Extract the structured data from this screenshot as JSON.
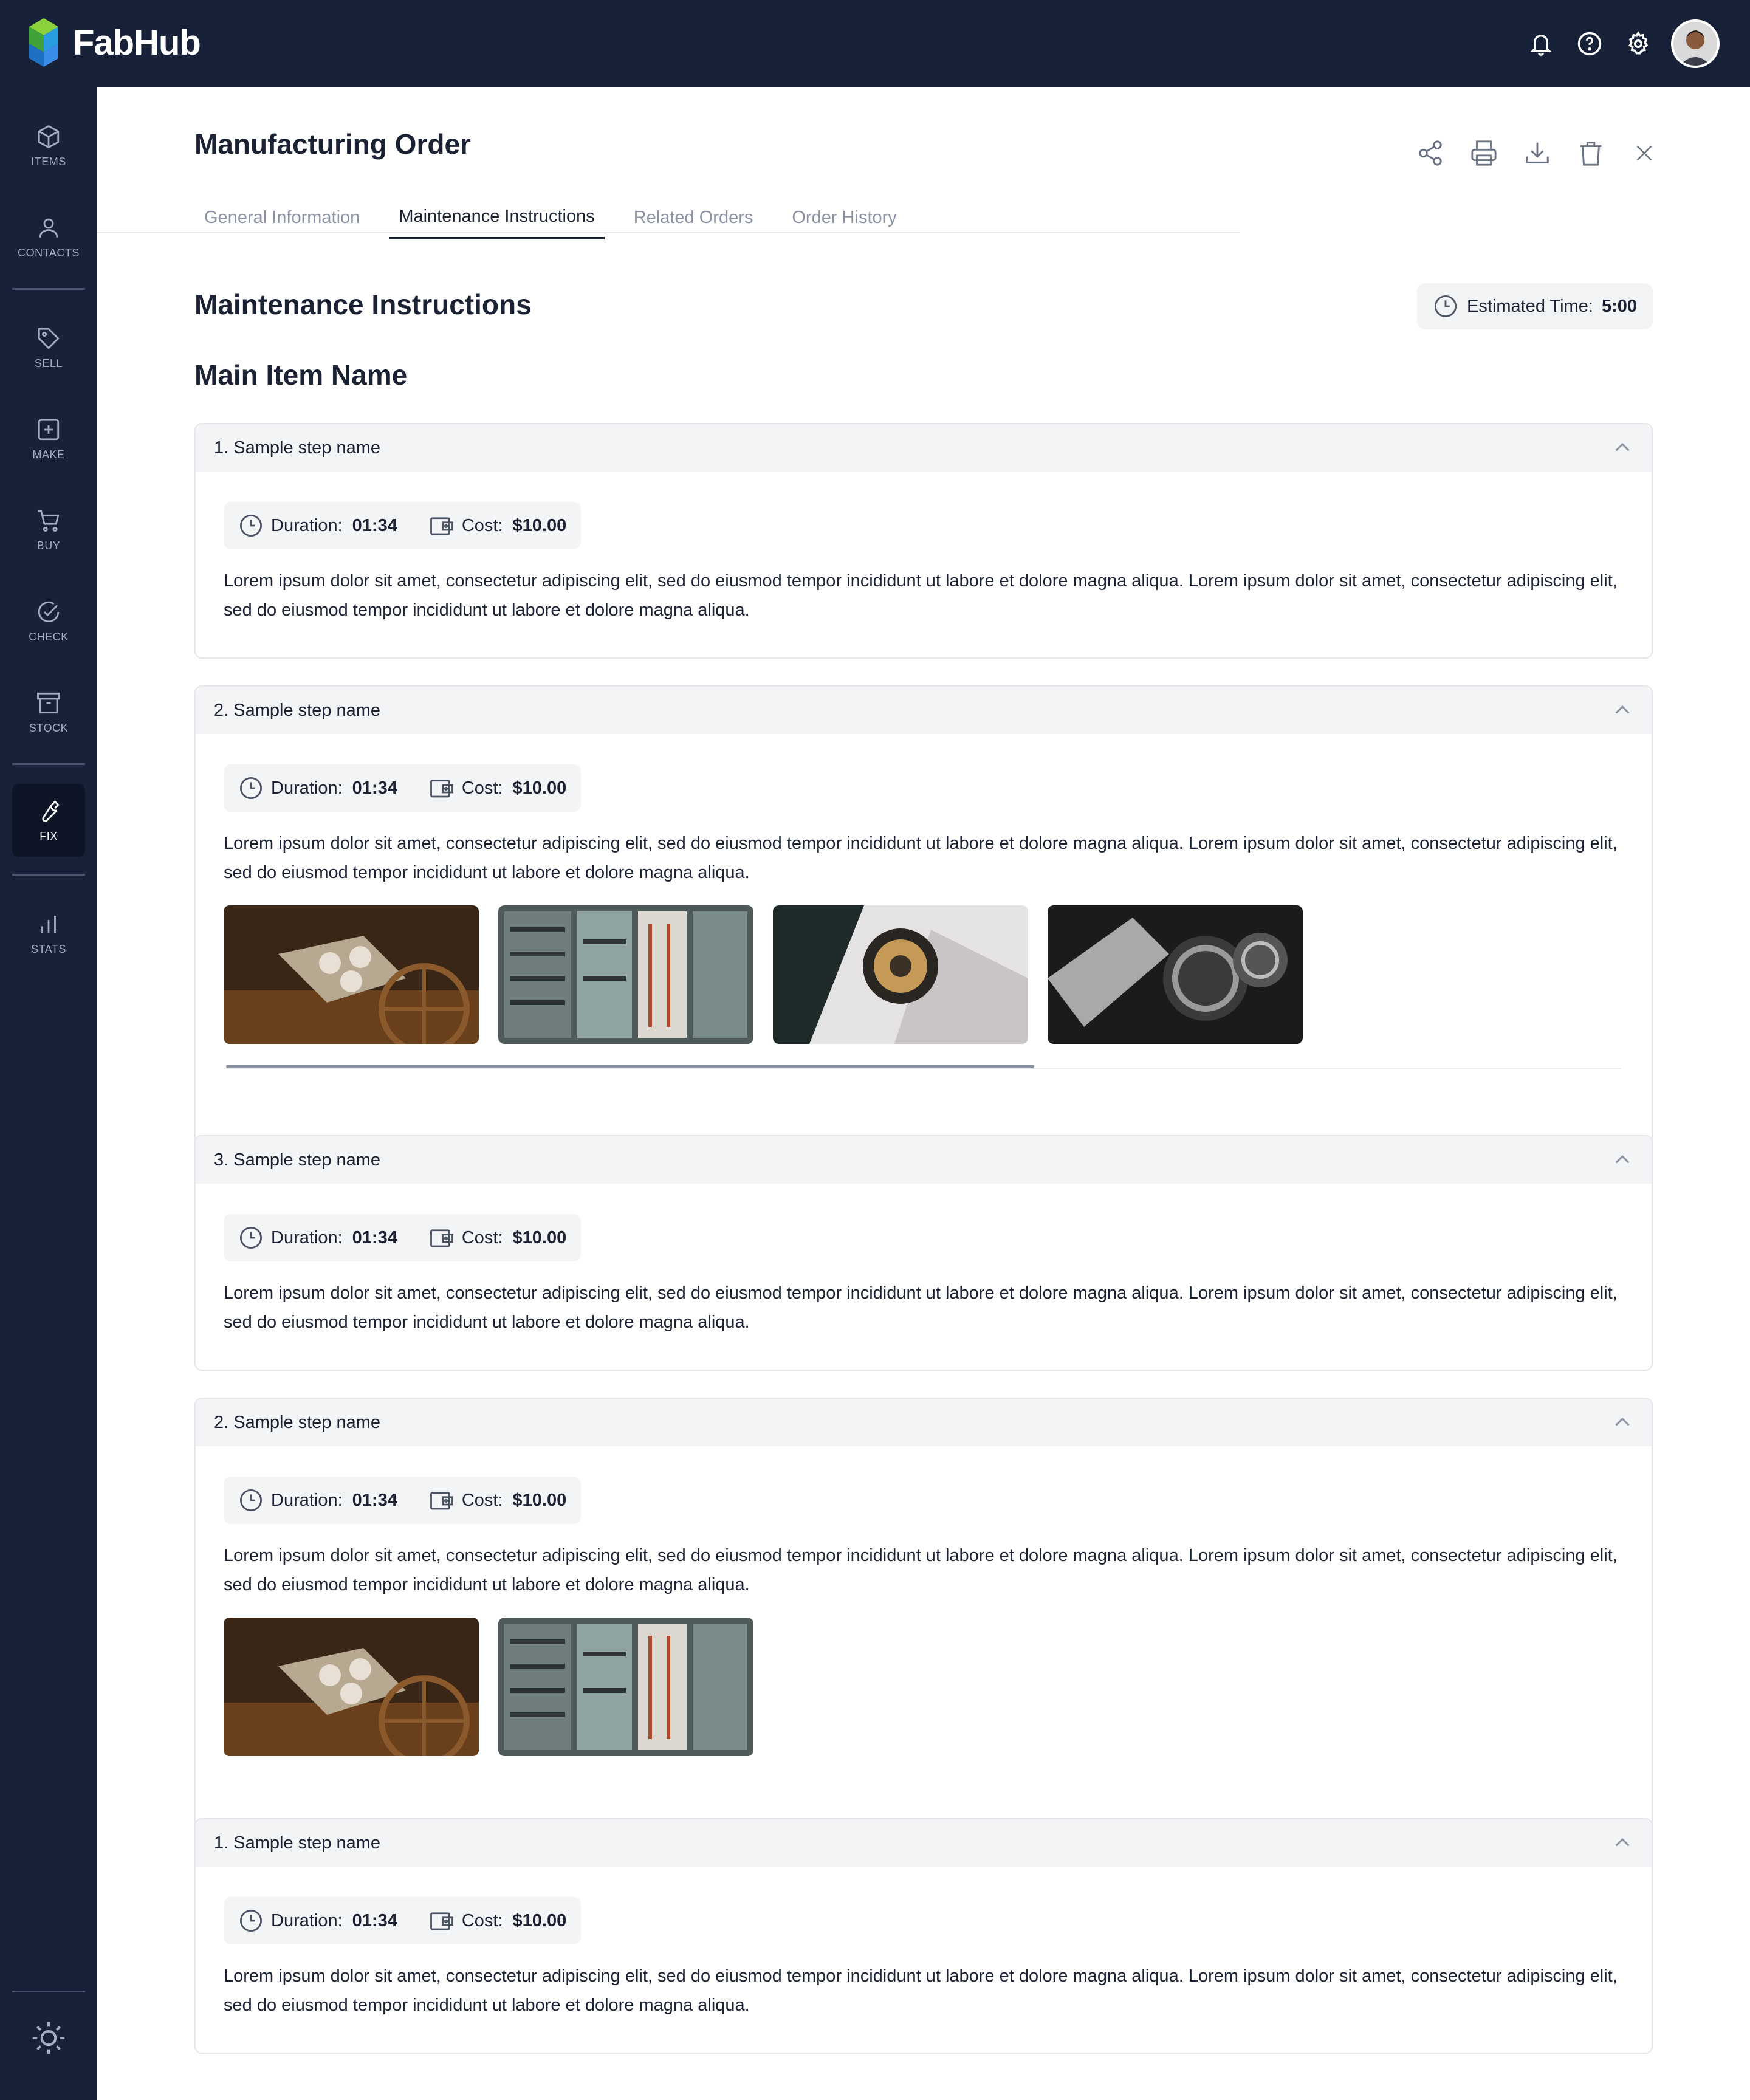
{
  "app": {
    "name": "FabHub"
  },
  "sidebar": {
    "items": [
      {
        "label": "ITEMS",
        "icon": "cube-icon"
      },
      {
        "label": "CONTACTS",
        "icon": "person-icon"
      },
      {
        "label": "SELL",
        "icon": "tag-icon"
      },
      {
        "label": "MAKE",
        "icon": "plus-square-icon"
      },
      {
        "label": "BUY",
        "icon": "cart-icon"
      },
      {
        "label": "CHECK",
        "icon": "check-circle-icon"
      },
      {
        "label": "STOCK",
        "icon": "archive-icon"
      },
      {
        "label": "FIX",
        "icon": "wrench-icon",
        "active": true
      },
      {
        "label": "STATS",
        "icon": "bar-chart-icon"
      }
    ]
  },
  "page": {
    "title": "Manufacturing Order",
    "tabs": [
      {
        "label": "General Information"
      },
      {
        "label": "Maintenance Instructions",
        "active": true
      },
      {
        "label": "Related Orders"
      },
      {
        "label": "Order History"
      }
    ],
    "section_title": "Maintenance Instructions",
    "estimated_label": "Estimated Time:",
    "estimated_value": "5:00",
    "item_name": "Main Item Name"
  },
  "steps": [
    {
      "name": "1. Sample step name",
      "duration_label": "Duration:",
      "duration": "01:34",
      "cost_label": "Cost:",
      "cost": "$10.00",
      "description": "Lorem ipsum dolor sit amet, consectetur adipiscing elit, sed do eiusmod tempor incididunt ut labore et dolore magna aliqua. Lorem ipsum dolor sit amet, consectetur adipiscing elit, sed do eiusmod tempor incididunt ut labore et dolore magna aliqua."
    },
    {
      "name": "2. Sample step name",
      "duration_label": "Duration:",
      "duration": "01:34",
      "cost_label": "Cost:",
      "cost": "$10.00",
      "description": "Lorem ipsum dolor sit amet, consectetur adipiscing elit, sed do eiusmod tempor incididunt ut labore et dolore magna aliqua. Lorem ipsum dolor sit amet, consectetur adipiscing elit, sed do eiusmod tempor incididunt ut labore et dolore magna aliqua."
    },
    {
      "name": "3. Sample step name",
      "duration_label": "Duration:",
      "duration": "01:34",
      "cost_label": "Cost:",
      "cost": "$10.00",
      "description": "Lorem ipsum dolor sit amet, consectetur adipiscing elit, sed do eiusmod tempor incididunt ut labore et dolore magna aliqua. Lorem ipsum dolor sit amet, consectetur adipiscing elit, sed do eiusmod tempor incididunt ut labore et dolore magna aliqua."
    },
    {
      "name": "2. Sample step name",
      "duration_label": "Duration:",
      "duration": "01:34",
      "cost_label": "Cost:",
      "cost": "$10.00",
      "description": "Lorem ipsum dolor sit amet, consectetur adipiscing elit, sed do eiusmod tempor incididunt ut labore et dolore magna aliqua. Lorem ipsum dolor sit amet, consectetur adipiscing elit, sed do eiusmod tempor incididunt ut labore et dolore magna aliqua."
    },
    {
      "name": "1. Sample step name",
      "duration_label": "Duration:",
      "duration": "01:34",
      "cost_label": "Cost:",
      "cost": "$10.00",
      "description": "Lorem ipsum dolor sit amet, consectetur adipiscing elit, sed do eiusmod tempor incididunt ut labore et dolore magna aliqua. Lorem ipsum dolor sit amet, consectetur adipiscing elit, sed do eiusmod tempor incididunt ut labore et dolore magna aliqua."
    }
  ],
  "colors": {
    "nav_bg": "#172239",
    "nav_active": "#0d1526",
    "header_bg": "#f3f4f6",
    "text": "#1a2233",
    "muted": "#8b93a3"
  }
}
